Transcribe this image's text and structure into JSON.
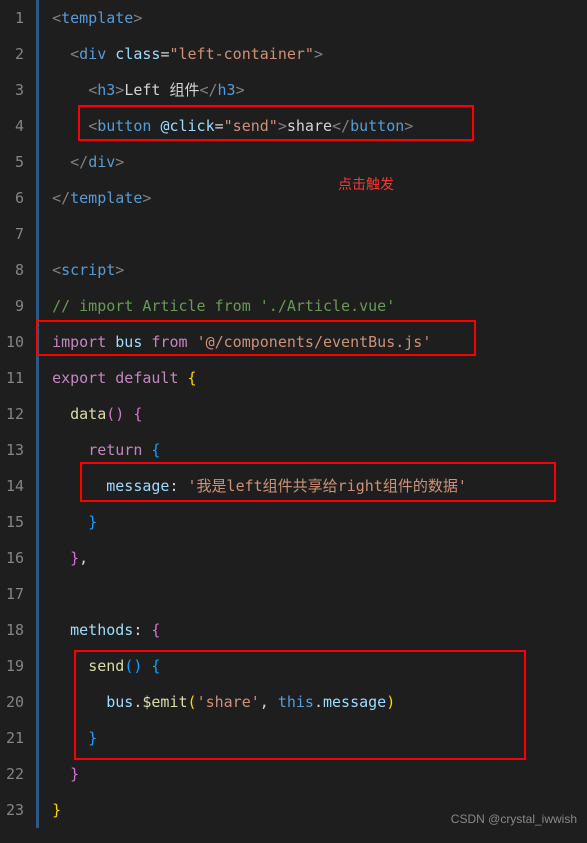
{
  "lines": [
    "1",
    "2",
    "3",
    "4",
    "5",
    "6",
    "7",
    "8",
    "9",
    "10",
    "11",
    "12",
    "13",
    "14",
    "15",
    "16",
    "17",
    "18",
    "19",
    "20",
    "21",
    "22",
    "23"
  ],
  "code": {
    "tag_template": "template",
    "tag_div": "div",
    "attr_class": "class",
    "val_leftcontainer": "\"left-container\"",
    "tag_h3": "h3",
    "text_leftcomp": "Left 组件",
    "tag_button": "button",
    "attr_click": "@click",
    "val_send": "\"send\"",
    "text_share": "share",
    "tag_script": "script",
    "comment_import": "// import Article from './Article.vue'",
    "kw_import": "import",
    "var_bus": "bus",
    "kw_from": "from",
    "str_eventbus": "'@/components/eventBus.js'",
    "kw_export": "export",
    "kw_default": "default",
    "fn_data": "data",
    "kw_return": "return",
    "var_message": "message",
    "str_message": "'我是left组件共享给right组件的数据'",
    "var_methods": "methods",
    "fn_send": "send",
    "fn_emit": "$emit",
    "str_share": "'share'",
    "kw_this": "this",
    "var_msg2": "message"
  },
  "annotation": "点击触发",
  "watermark": "CSDN @crystal_iwwish"
}
